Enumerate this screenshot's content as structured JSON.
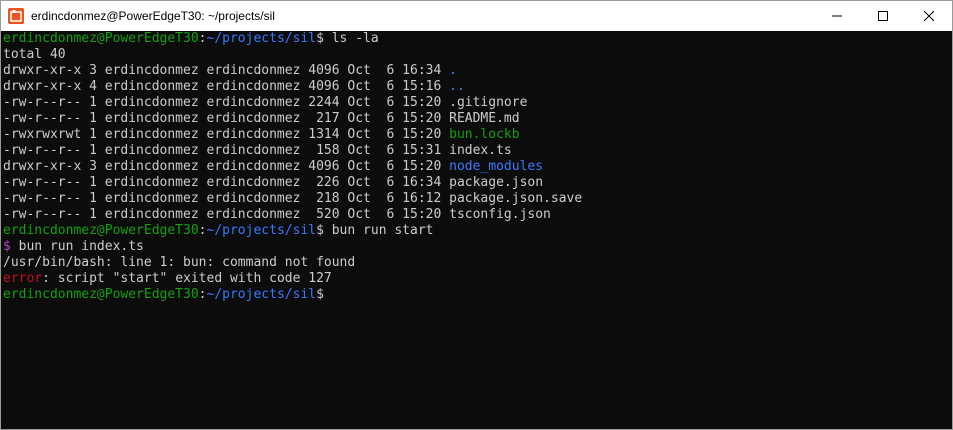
{
  "window": {
    "title": "erdincdonmez@PowerEdgeT30: ~/projects/sil",
    "icon": "ubuntu-icon"
  },
  "controls": {
    "minimize_icon": "minimize-icon",
    "maximize_icon": "maximize-icon",
    "close_icon": "close-icon"
  },
  "colors": {
    "background": "#0c0c0c",
    "text": "#cccccc",
    "prompt_user": "#13a10e",
    "prompt_path": "#3b78ff",
    "directory": "#3b78ff",
    "executable": "#13a10e",
    "bun_dollar": "#b148c6",
    "error": "#c50f1f"
  },
  "terminal": {
    "prompt1": {
      "user": "erdincdonmez@PowerEdgeT30",
      "sep": ":",
      "path": "~/projects/sil",
      "dollar": "$ ",
      "command": "ls -la"
    },
    "total": "total 40",
    "listing": [
      {
        "meta": "drwxr-xr-x 3 erdincdonmez erdincdonmez 4096 Oct  6 16:34 ",
        "name": ".",
        "type": "dir"
      },
      {
        "meta": "drwxr-xr-x 4 erdincdonmez erdincdonmez 4096 Oct  6 15:16 ",
        "name": "..",
        "type": "dir"
      },
      {
        "meta": "-rw-r--r-- 1 erdincdonmez erdincdonmez 2244 Oct  6 15:20 ",
        "name": ".gitignore",
        "type": "file"
      },
      {
        "meta": "-rw-r--r-- 1 erdincdonmez erdincdonmez  217 Oct  6 15:20 ",
        "name": "README.md",
        "type": "file"
      },
      {
        "meta": "-rwxrwxrwt 1 erdincdonmez erdincdonmez 1314 Oct  6 15:20 ",
        "name": "bun.lockb",
        "type": "exec"
      },
      {
        "meta": "-rw-r--r-- 1 erdincdonmez erdincdonmez  158 Oct  6 15:31 ",
        "name": "index.ts",
        "type": "file"
      },
      {
        "meta": "drwxr-xr-x 3 erdincdonmez erdincdonmez 4096 Oct  6 15:20 ",
        "name": "node_modules",
        "type": "dir"
      },
      {
        "meta": "-rw-r--r-- 1 erdincdonmez erdincdonmez  226 Oct  6 16:34 ",
        "name": "package.json",
        "type": "file"
      },
      {
        "meta": "-rw-r--r-- 1 erdincdonmez erdincdonmez  218 Oct  6 16:12 ",
        "name": "package.json.save",
        "type": "file"
      },
      {
        "meta": "-rw-r--r-- 1 erdincdonmez erdincdonmez  520 Oct  6 15:20 ",
        "name": "tsconfig.json",
        "type": "file"
      }
    ],
    "prompt2": {
      "user": "erdincdonmez@PowerEdgeT30",
      "sep": ":",
      "path": "~/projects/sil",
      "dollar": "$ ",
      "command": "bun run start"
    },
    "bun_line": {
      "dollar": "$",
      "command": " bun run index.ts"
    },
    "bash_error": "/usr/bin/bash: line 1: bun: command not found",
    "script_error": {
      "label": "error",
      "message": ": script \"start\" exited with code 127"
    },
    "prompt3": {
      "user": "erdincdonmez@PowerEdgeT30",
      "sep": ":",
      "path": "~/projects/sil",
      "dollar": "$"
    }
  }
}
